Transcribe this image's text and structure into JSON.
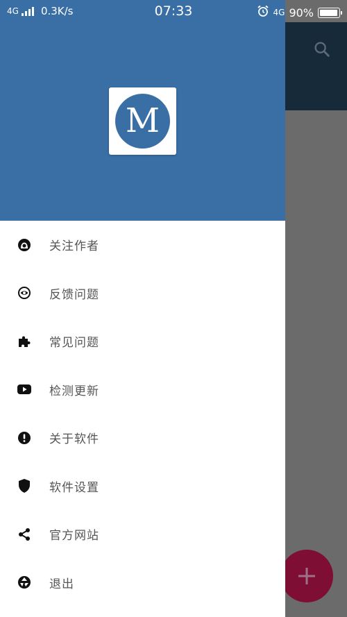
{
  "status_bar": {
    "network": "4G",
    "speed": "0.3K/s",
    "time": "07:33",
    "network_right": "4G",
    "battery": "90%"
  },
  "drawer": {
    "logo_letter": "M",
    "items": [
      {
        "icon": "github-icon",
        "label": "关注作者"
      },
      {
        "icon": "feedback-eye-icon",
        "label": "反馈问题"
      },
      {
        "icon": "puzzle-icon",
        "label": "常见问题"
      },
      {
        "icon": "youtube-play-icon",
        "label": "检测更新"
      },
      {
        "icon": "exclamation-circle-icon",
        "label": "关于软件"
      },
      {
        "icon": "shield-icon",
        "label": "软件设置"
      },
      {
        "icon": "share-icon",
        "label": "官方网站"
      },
      {
        "icon": "aperture-icon",
        "label": "退出"
      }
    ]
  },
  "colors": {
    "drawer_header": "#3a6fa6",
    "toolbar_dimmed": "#172a3a",
    "scrim": "#6b6b6b",
    "fab": "#7e0e33",
    "label_text": "#555555"
  }
}
